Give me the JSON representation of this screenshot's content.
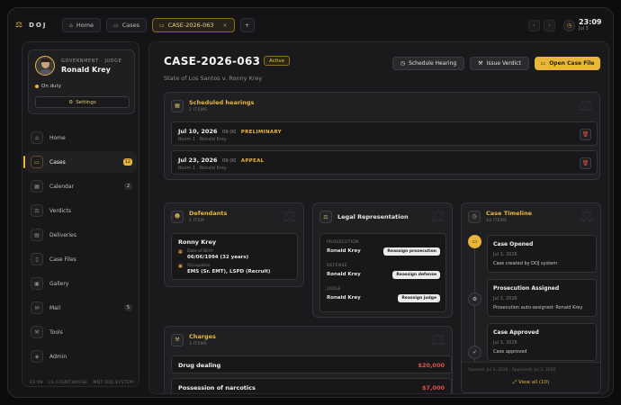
{
  "app": {
    "brand": "DOJ"
  },
  "tabs": [
    {
      "label": "Home"
    },
    {
      "label": "Cases"
    },
    {
      "label": "CASE-2026-063",
      "active": true
    }
  ],
  "clock": {
    "time": "23:09",
    "date": "Jul 3"
  },
  "profile": {
    "role": "GOVERNMENT · JUDGE",
    "name": "Ronald Krey",
    "status": "On duty",
    "settings_label": "Settings"
  },
  "nav": [
    {
      "label": "Home",
      "icon": "home-icon",
      "glyph": "⌂"
    },
    {
      "label": "Cases",
      "icon": "folder-icon",
      "glyph": "▭",
      "badge": "12",
      "active": true
    },
    {
      "label": "Calendar",
      "icon": "calendar-icon",
      "glyph": "▦",
      "badge": "2"
    },
    {
      "label": "Verdicts",
      "icon": "scales-icon",
      "glyph": "⚖"
    },
    {
      "label": "Deliveries",
      "icon": "inbox-icon",
      "glyph": "▤"
    },
    {
      "label": "Case Files",
      "icon": "file-icon",
      "glyph": "▯"
    },
    {
      "label": "Gallery",
      "icon": "image-icon",
      "glyph": "▣"
    },
    {
      "label": "Mail",
      "icon": "mail-icon",
      "glyph": "✉",
      "badge": "5"
    },
    {
      "label": "Tools",
      "icon": "wrench-icon",
      "glyph": "⚒"
    },
    {
      "label": "Admin",
      "icon": "shield-icon",
      "glyph": "◈"
    }
  ],
  "sidebar_footer": {
    "time": "23:09",
    "location": "LS COURTHOUSE",
    "system": "MDT DOJ SYSTEM"
  },
  "case": {
    "id": "CASE-2026-063",
    "status": "Active",
    "subtitle": "State of Los Santos v. Ronny Krey"
  },
  "actions": {
    "schedule": "Schedule Hearing",
    "verdict": "Issue Verdict",
    "open_file": "Open Case File"
  },
  "hearings": {
    "title": "Scheduled hearings",
    "count": "2 ITEMS",
    "items": [
      {
        "date": "Jul 10, 2026",
        "time": "09:00",
        "type": "PRELIMINARY",
        "room": "Room 1 · Ronald Krey"
      },
      {
        "date": "Jul 23, 2026",
        "time": "09:00",
        "type": "APPEAL",
        "room": "Room 1 · Ronald Krey"
      }
    ]
  },
  "defendants": {
    "title": "Defendants",
    "count": "1 ITEM",
    "name": "Ronny Krey",
    "dob_label": "Date of Birth",
    "dob": "06/06/1994 (32 years)",
    "occ_label": "Occupation",
    "occupation": "EMS (Sr. EMT), LSPD (Recruit)"
  },
  "legal": {
    "title": "Legal Representation",
    "roles": [
      {
        "label": "PROSECUTION",
        "name": "Ronald Krey",
        "action": "Reassign prosecution"
      },
      {
        "label": "DEFENSE",
        "name": "Ronald Krey",
        "action": "Reassign defense"
      },
      {
        "label": "JUDGE",
        "name": "Ronald Krey",
        "action": "Reassign judge"
      }
    ]
  },
  "timeline": {
    "title": "Case Timeline",
    "count": "10 ITEMS",
    "events": [
      {
        "title": "Case Opened",
        "date": "Jul 3, 2026",
        "text": "Case created by DOJ system"
      },
      {
        "title": "Prosecution Assigned",
        "date": "Jul 3, 2026",
        "text": "Prosecution auto-assigned: Ronald Krey"
      },
      {
        "title": "Case Approved",
        "date": "Jul 3, 2026",
        "text": "Case approved"
      }
    ],
    "meta": "Opened: Jul 3, 2026 · Approved: Jul 3, 2026",
    "view_all": "View all (10)"
  },
  "charges": {
    "title": "Charges",
    "count": "3 ITEMS",
    "items": [
      {
        "name": "Drug dealing",
        "amount": "$20,000"
      },
      {
        "name": "Possession of narcotics",
        "amount": "$7,000"
      }
    ]
  },
  "colors": {
    "accent": "#e8b73a",
    "danger": "#e0504a",
    "background": "#141416"
  }
}
